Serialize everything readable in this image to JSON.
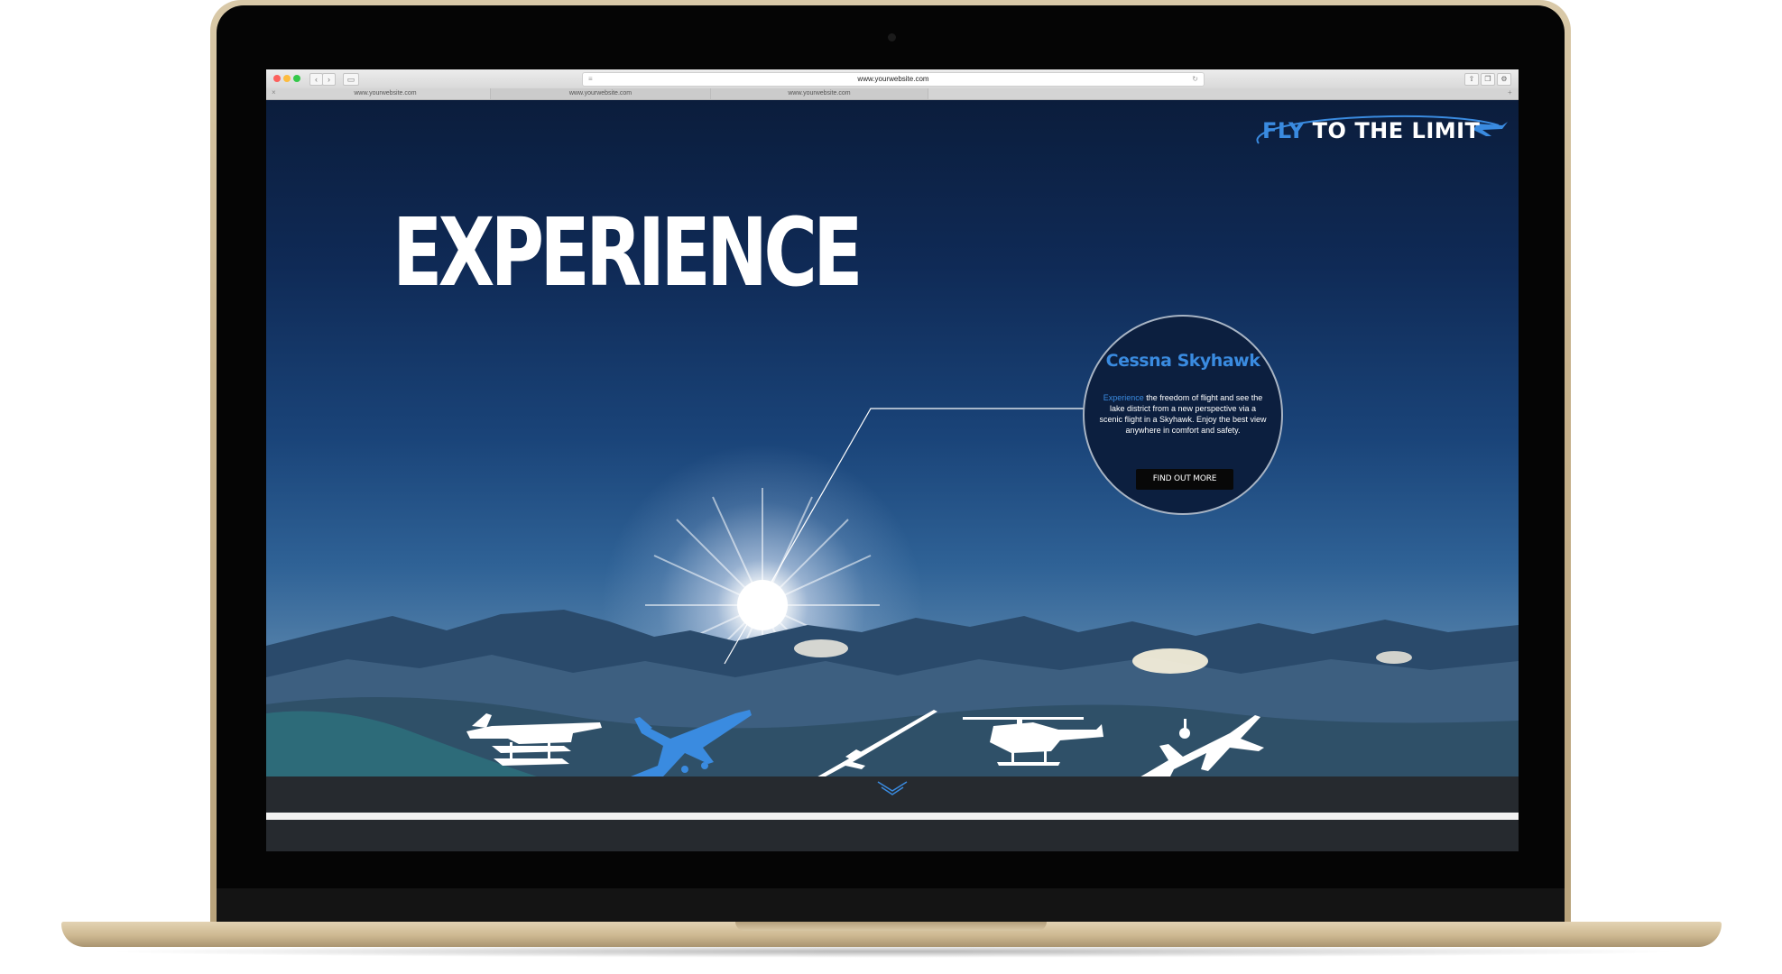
{
  "browser": {
    "address": "www.yourwebsite.com",
    "tabs": [
      {
        "label": "www.yourwebsite.com"
      },
      {
        "label": "www.yourwebsite.com"
      },
      {
        "label": "www.yourwebsite.com"
      }
    ]
  },
  "site": {
    "logo": {
      "part1": "FLY",
      "part2": " TO THE LIMIT"
    },
    "headline": "EXPERIENCE",
    "feature": {
      "title": "Cessna Skyhawk",
      "highlight": "Experience",
      "body": " the freedom of flight and see the lake district from a new perspective via a scenic flight in a Skyhawk. Enjoy the best view anywhere in comfort and safety.",
      "button_label": "FIND OUT MORE"
    },
    "aircraft": [
      {
        "name": "seaplane-icon",
        "selected": false
      },
      {
        "name": "cessna-icon",
        "selected": true
      },
      {
        "name": "glider-icon",
        "selected": false
      },
      {
        "name": "helicopter-icon",
        "selected": false
      },
      {
        "name": "jet-plane-icon",
        "selected": false
      }
    ]
  },
  "colors": {
    "accent": "#3a8be0",
    "sky_dark": "#0b1d3c",
    "strip": "#262a2f",
    "bezel": "#050505",
    "laptop_gold": "#c7b28c"
  }
}
